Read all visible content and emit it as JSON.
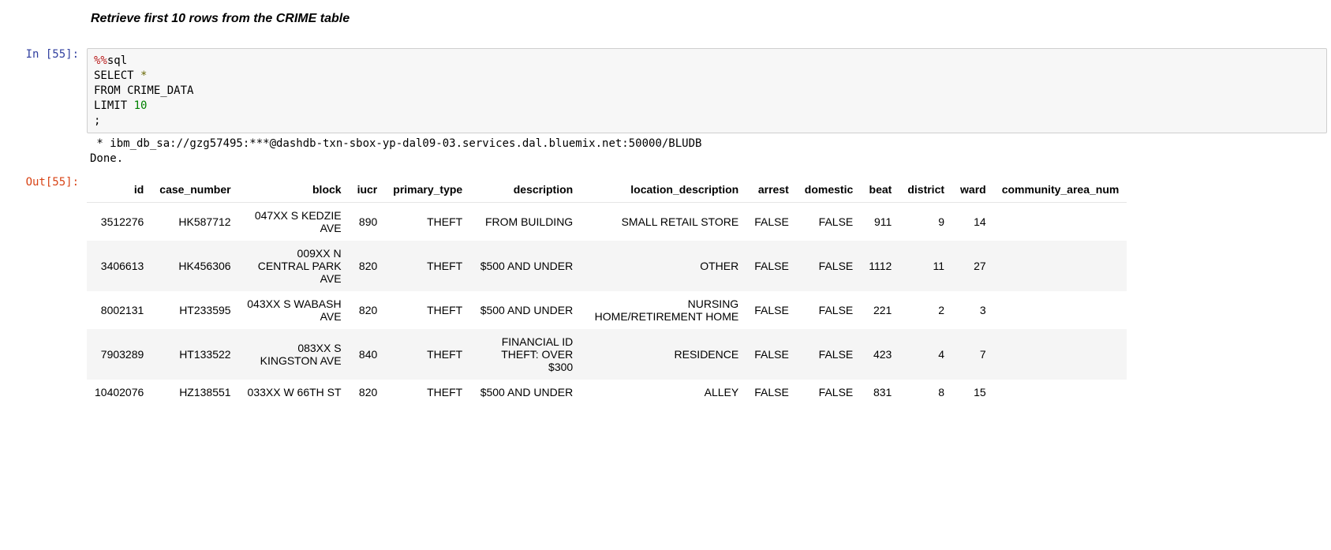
{
  "markdown": {
    "heading": "Retrieve first 10 rows from the CRIME table"
  },
  "execution": {
    "in_prompt": "In [55]:",
    "out_prompt": "Out[55]:",
    "code": {
      "magic": "%%",
      "magic_name": "sql",
      "line1a": "SELECT ",
      "line1b": "*",
      "line2": "FROM CRIME_DATA",
      "line3a": "LIMIT ",
      "line3b": "10",
      "line4": ";"
    },
    "stream": " * ibm_db_sa://gzg57495:***@dashdb-txn-sbox-yp-dal09-03.services.dal.bluemix.net:50000/BLUDB\nDone."
  },
  "table": {
    "headers": [
      "id",
      "case_number",
      "block",
      "iucr",
      "primary_type",
      "description",
      "location_description",
      "arrest",
      "domestic",
      "beat",
      "district",
      "ward",
      "community_area_num"
    ],
    "rows": [
      {
        "id": "3512276",
        "case_number": "HK587712",
        "block": "047XX S KEDZIE AVE",
        "iucr": "890",
        "primary_type": "THEFT",
        "description": "FROM BUILDING",
        "location_description": "SMALL RETAIL STORE",
        "arrest": "FALSE",
        "domestic": "FALSE",
        "beat": "911",
        "district": "9",
        "ward": "14",
        "community_area_num": ""
      },
      {
        "id": "3406613",
        "case_number": "HK456306",
        "block": "009XX N CENTRAL PARK AVE",
        "iucr": "820",
        "primary_type": "THEFT",
        "description": "$500 AND UNDER",
        "location_description": "OTHER",
        "arrest": "FALSE",
        "domestic": "FALSE",
        "beat": "1112",
        "district": "11",
        "ward": "27",
        "community_area_num": ""
      },
      {
        "id": "8002131",
        "case_number": "HT233595",
        "block": "043XX S WABASH AVE",
        "iucr": "820",
        "primary_type": "THEFT",
        "description": "$500 AND UNDER",
        "location_description": "NURSING HOME/RETIREMENT HOME",
        "arrest": "FALSE",
        "domestic": "FALSE",
        "beat": "221",
        "district": "2",
        "ward": "3",
        "community_area_num": ""
      },
      {
        "id": "7903289",
        "case_number": "HT133522",
        "block": "083XX S KINGSTON AVE",
        "iucr": "840",
        "primary_type": "THEFT",
        "description": "FINANCIAL ID THEFT: OVER $300",
        "location_description": "RESIDENCE",
        "arrest": "FALSE",
        "domestic": "FALSE",
        "beat": "423",
        "district": "4",
        "ward": "7",
        "community_area_num": ""
      },
      {
        "id": "10402076",
        "case_number": "HZ138551",
        "block": "033XX W 66TH ST",
        "iucr": "820",
        "primary_type": "THEFT",
        "description": "$500 AND UNDER",
        "location_description": "ALLEY",
        "arrest": "FALSE",
        "domestic": "FALSE",
        "beat": "831",
        "district": "8",
        "ward": "15",
        "community_area_num": ""
      }
    ]
  }
}
